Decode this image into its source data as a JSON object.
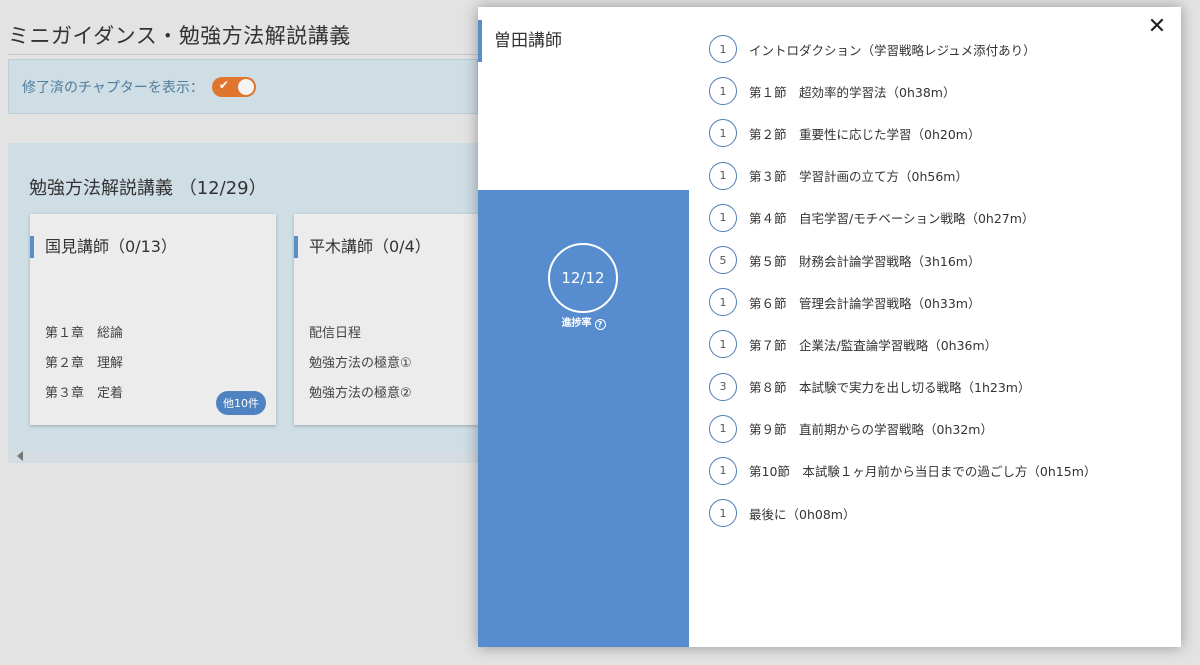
{
  "page": {
    "title": "ミニガイダンス・勉強方法解説講義",
    "toggle_label": "修了済のチャプターを表示：",
    "toggle_check": "✔"
  },
  "course": {
    "title": "勉強方法解説講義 （12/29）",
    "teachers": [
      {
        "name": "国見講師（0/13）",
        "items": [
          "第１章　総論",
          "第２章　理解",
          "第３章　定着"
        ],
        "more": "他10件"
      },
      {
        "name": "平木講師（0/4）",
        "items": [
          "配信日程",
          "勉強方法の極意①",
          "勉強方法の極意②"
        ]
      }
    ]
  },
  "modal": {
    "teacher": "曽田講師",
    "progress": "12/12",
    "progress_label": "進捗率",
    "help": "?",
    "close": "✕",
    "chapters": [
      {
        "count": "1",
        "title": "イントロダクション（学習戦略レジュメ添付あり）"
      },
      {
        "count": "1",
        "title": "第１節　超効率的学習法（0h38m）"
      },
      {
        "count": "1",
        "title": "第２節　重要性に応じた学習（0h20m）"
      },
      {
        "count": "1",
        "title": "第３節　学習計画の立て方（0h56m）"
      },
      {
        "count": "1",
        "title": "第４節　自宅学習/モチベーション戦略（0h27m）"
      },
      {
        "count": "5",
        "title": "第５節　財務会計論学習戦略（3h16m）"
      },
      {
        "count": "1",
        "title": "第６節　管理会計論学習戦略（0h33m）"
      },
      {
        "count": "1",
        "title": "第７節　企業法/監査論学習戦略（0h36m）"
      },
      {
        "count": "3",
        "title": "第８節　本試験で実力を出し切る戦略（1h23m）"
      },
      {
        "count": "1",
        "title": "第９節　直前期からの学習戦略（0h32m）"
      },
      {
        "count": "1",
        "title": "第10節　本試験１ヶ月前から当日までの過ごし方（0h15m）"
      },
      {
        "count": "1",
        "title": "最後に（0h08m）"
      }
    ]
  }
}
